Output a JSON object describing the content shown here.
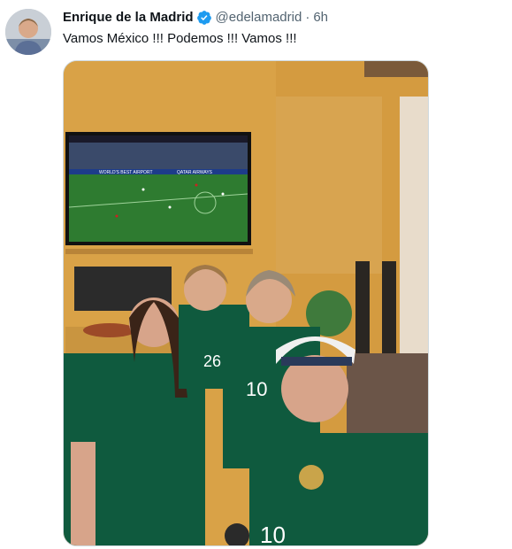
{
  "tweet": {
    "author_name": "Enrique de la Madrid",
    "handle": "@edelamadrid",
    "separator": "·",
    "time": "6h",
    "text": "Vamos México !!! Podemos !!! Vamos !!!",
    "verified_icon": "verified-badge-icon",
    "media": {
      "tv_banner": "WORLD'S BEST AIRPORT",
      "tv_sponsor": "QATAR AIRWAYS",
      "jersey_numbers": [
        "26",
        "10",
        "10"
      ]
    }
  },
  "colors": {
    "name": "#0f1419",
    "secondary": "#536471",
    "verified": "#1d9bf0",
    "wall": "#d9a247",
    "jersey": "#0f5a3e"
  }
}
